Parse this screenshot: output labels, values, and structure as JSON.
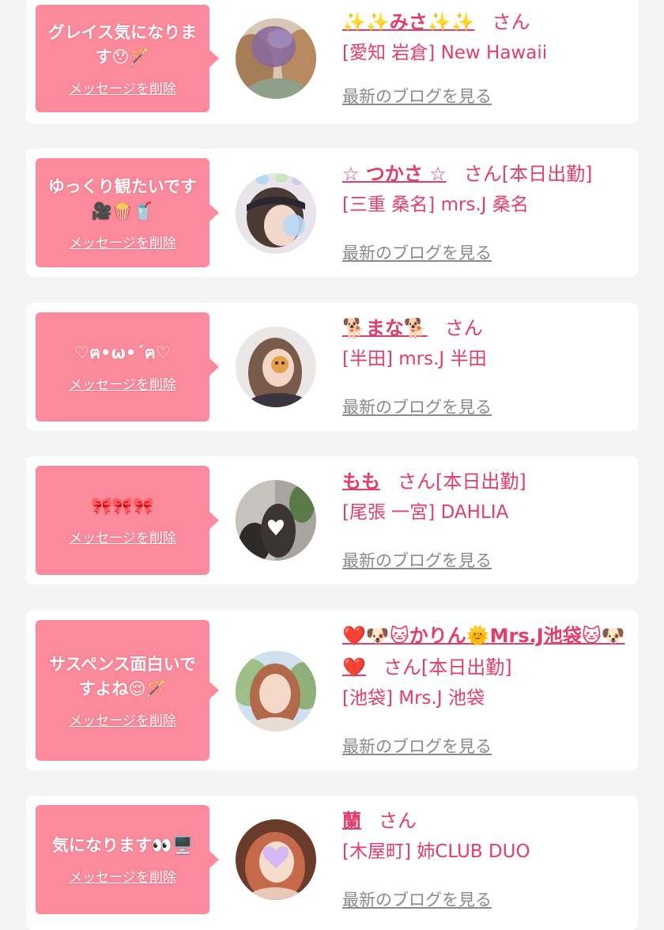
{
  "messages": [
    {
      "bubble_text": "グレイス気になります😯🪄",
      "delete_label": "メッセージを削除",
      "name": "✨✨みさ✨✨",
      "san_label": "さん",
      "shop": "[愛知 岩倉] New Hawaii",
      "blog_label": "最新のブログを見る",
      "avatar_colors": [
        "#d9c7b4",
        "#8a6a9a"
      ],
      "avatar_icon": "purple-face-blur"
    },
    {
      "bubble_text": "ゆっくり観たいです🎥🍿🥤",
      "delete_label": "メッセージを削除",
      "name": "☆ つかさ ☆",
      "san_label": "さん[本日出勤]",
      "shop": "[三重 桑名] mrs.J 桑名",
      "blog_label": "最新のブログを見る",
      "avatar_colors": [
        "#e9e3ea",
        "#3a3442"
      ],
      "avatar_icon": "face-blur"
    },
    {
      "bubble_text": "♡ฅ•ω•´ฅ♡",
      "delete_label": "メッセージを削除",
      "name": "🐕まな🐕",
      "san_label": "さん",
      "shop": "[半田] mrs.J 半田",
      "blog_label": "最新のブログを見る",
      "avatar_colors": [
        "#ebe7e6",
        "#7a5a4a"
      ],
      "avatar_icon": "dog-sticker"
    },
    {
      "bubble_text": "🎀🎀🎀",
      "delete_label": "メッセージを削除",
      "name": "もも",
      "san_label": "さん[本日出勤]",
      "shop": "[尾張 一宮] DAHLIA",
      "blog_label": "最新のブログを見る",
      "avatar_colors": [
        "#a8a4a0",
        "#3c3430"
      ],
      "avatar_icon": "heart-sticker"
    },
    {
      "bubble_text": "サスペンス面白いですよね😌🪄",
      "delete_label": "メッセージを削除",
      "name": "❤️🐶🐱かりん🌞Mrs.J池袋🐱🐶❤️",
      "san_label": "さん[本日出勤]",
      "shop": "[池袋] Mrs.J 池袋",
      "blog_label": "最新のブログを見る",
      "avatar_colors": [
        "#b8d0a8",
        "#d8b09a"
      ],
      "avatar_icon": "portrait"
    },
    {
      "bubble_text": "気になります👀🖥️",
      "delete_label": "メッセージを削除",
      "name": "蘭",
      "san_label": "さん",
      "shop": "[木屋町] 姉CLUB DUO",
      "blog_label": "最新のブログを見る",
      "avatar_colors": [
        "#6a3a2a",
        "#c46a4a"
      ],
      "avatar_icon": "heart-face-sticker"
    }
  ]
}
